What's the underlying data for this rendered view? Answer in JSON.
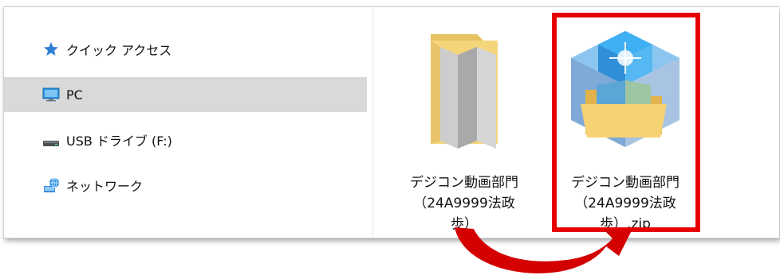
{
  "sidebar": {
    "items": [
      {
        "label": "クイック アクセス",
        "icon": "star-icon"
      },
      {
        "label": "PC",
        "icon": "monitor-icon",
        "selected": true
      },
      {
        "label": "USB ドライブ (F:)",
        "icon": "usb-drive-icon"
      },
      {
        "label": "ネットワーク",
        "icon": "network-icon"
      }
    ]
  },
  "files": [
    {
      "label": "デジコン動画部門\n（24A9999法政\n歩）",
      "icon": "folder-icon"
    },
    {
      "label": "デジコン動画部門\n（24A9999法政\n歩）.zip",
      "icon": "zip-folder-icon"
    }
  ],
  "colors": {
    "highlight": "#e60000",
    "selected_bg": "#d9d9d9",
    "arrow": "#d40000"
  }
}
